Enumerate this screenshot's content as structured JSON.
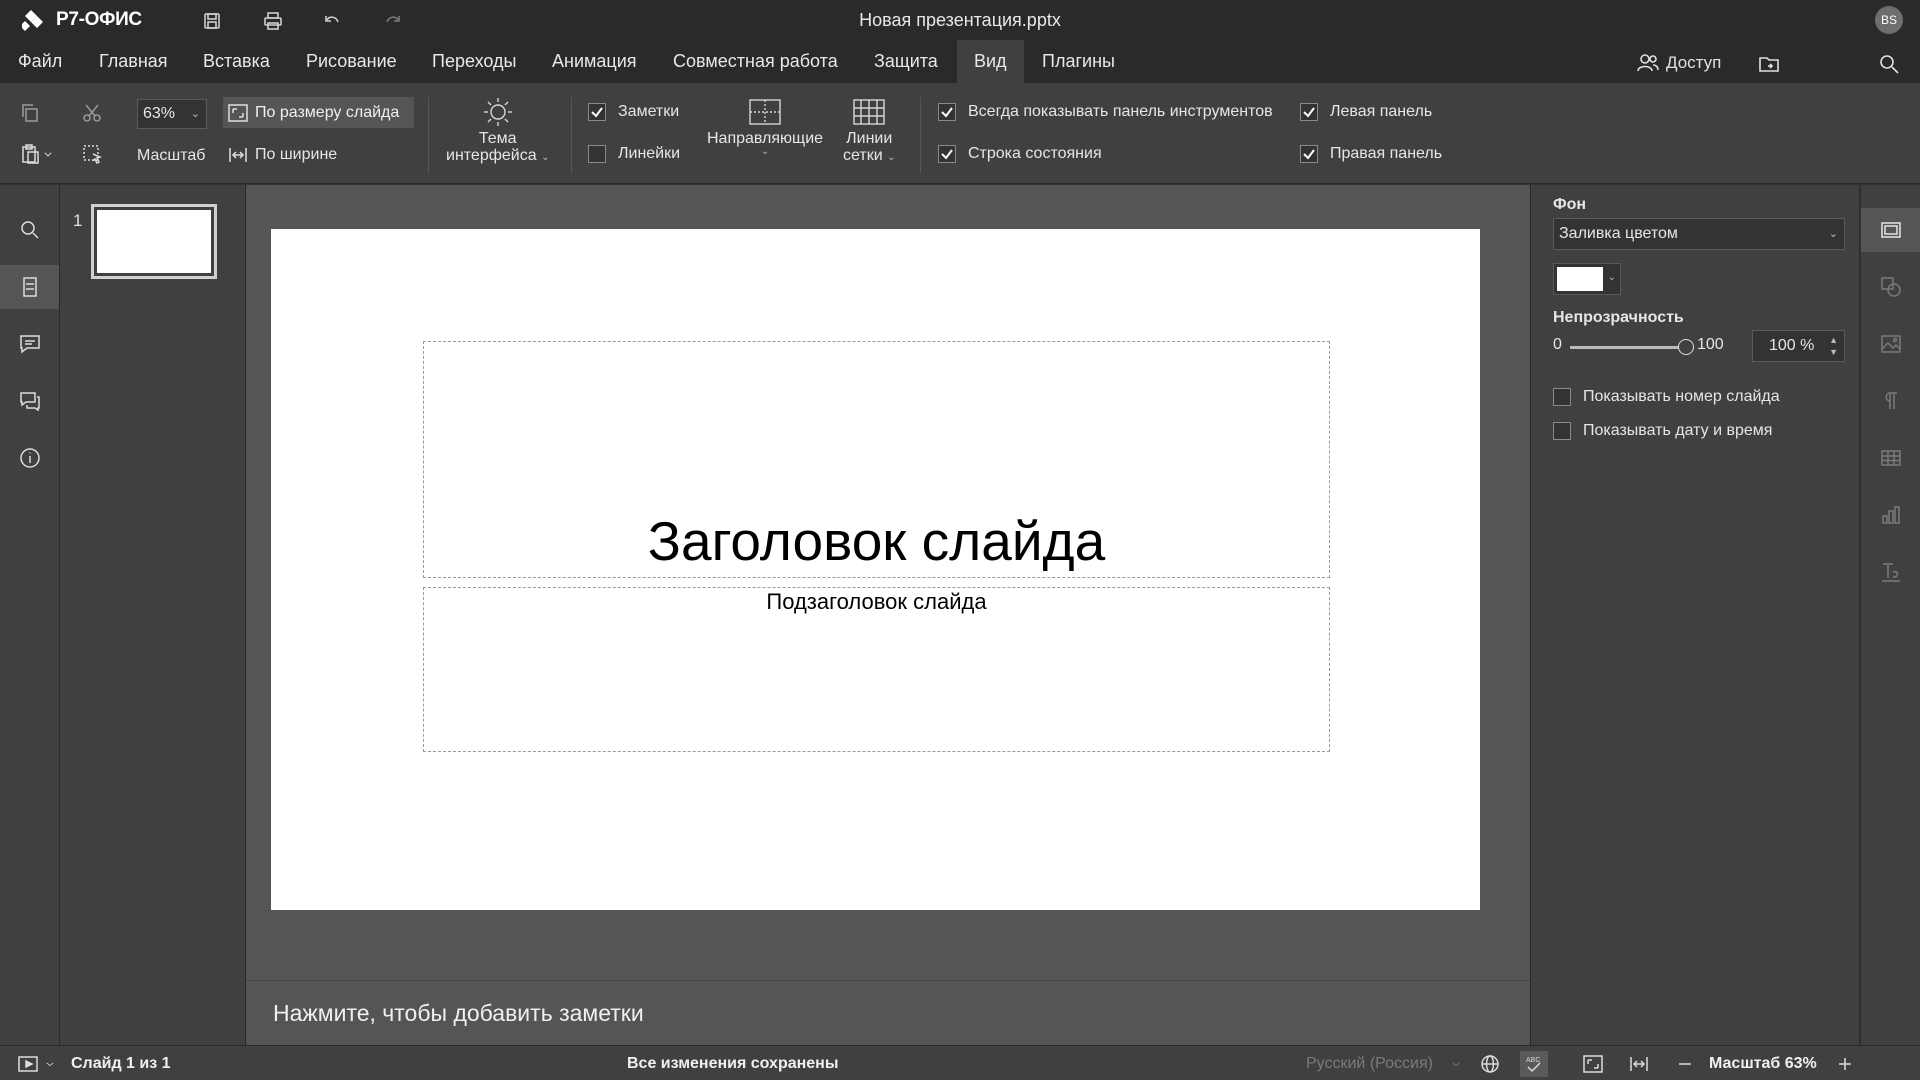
{
  "app": {
    "logo": "Р7-ОФИС",
    "document_title": "Новая презентация.pptx",
    "user_initials": "BS"
  },
  "menu": {
    "tabs": [
      "Файл",
      "Главная",
      "Вставка",
      "Рисование",
      "Переходы",
      "Анимация",
      "Совместная работа",
      "Защита",
      "Вид",
      "Плагины"
    ],
    "active_tab": "Вид",
    "access": "Доступ"
  },
  "toolbar": {
    "zoom_value": "63%",
    "zoom_label": "Масштаб",
    "fit_slide": "По размеру слайда",
    "fit_width": "По ширине",
    "theme_line1": "Тема",
    "theme_line2": "интерфейса",
    "notes": "Заметки",
    "notes_checked": true,
    "rulers": "Линейки",
    "rulers_checked": false,
    "guides": "Направляющие",
    "gridlines_line1": "Линии",
    "gridlines_line2": "сетки",
    "always_show_toolbar": "Всегда показывать панель инструментов",
    "always_show_toolbar_checked": true,
    "status_bar": "Строка состояния",
    "status_bar_checked": true,
    "left_panel": "Левая панель",
    "left_panel_checked": true,
    "right_panel": "Правая панель",
    "right_panel_checked": true
  },
  "thumbnails": {
    "items": [
      {
        "number": "1"
      }
    ]
  },
  "slide": {
    "title": "Заголовок слайда",
    "subtitle": "Подзаголовок слайда"
  },
  "notes": {
    "placeholder": "Нажмите, чтобы добавить заметки"
  },
  "settings_panel": {
    "background_label": "Фон",
    "fill_type": "Заливка цветом",
    "fill_color": "#ffffff",
    "opacity_label": "Непрозрачность",
    "opacity_min": "0",
    "opacity_max": "100",
    "opacity_value": 100,
    "opacity_text": "100 %",
    "show_slide_number": "Показывать номер слайда",
    "show_slide_number_checked": false,
    "show_date_time": "Показывать дату и время",
    "show_date_time_checked": false
  },
  "statusbar": {
    "slide_counter": "Слайд 1 из 1",
    "save_status": "Все изменения сохранены",
    "language": "Русский (Россия)",
    "zoom_text": "Масштаб 63%"
  },
  "colors": {
    "chrome_dark": "#2a2a2a",
    "panel": "#404040",
    "canvas": "#555555",
    "slide": "#ffffff"
  }
}
